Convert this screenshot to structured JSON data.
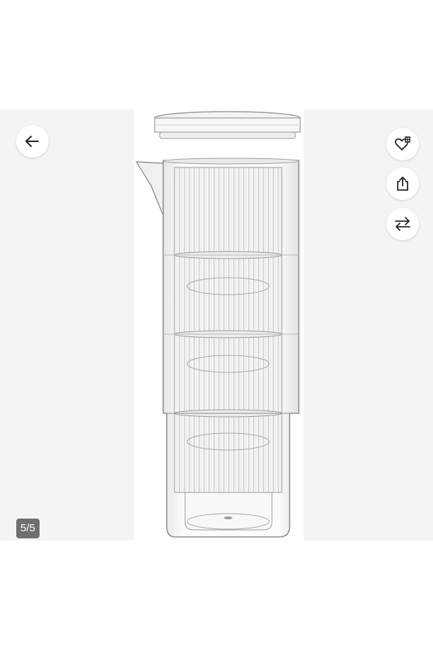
{
  "gallery": {
    "counter": "5/5",
    "image_subject": "pitcher-with-stacked-cups",
    "background_color": "#f4f4f4"
  },
  "actions": {
    "back_icon": "arrow-left-icon",
    "wishlist_icon": "heart-plus-icon",
    "share_icon": "share-icon",
    "compare_icon": "compare-arrows-icon"
  }
}
